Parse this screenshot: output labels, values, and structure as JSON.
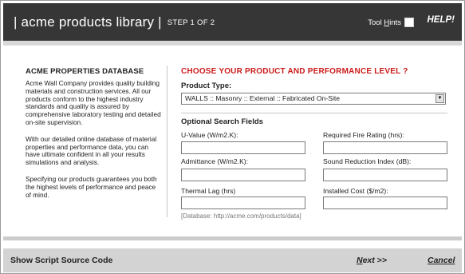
{
  "header": {
    "title": "| acme products library |",
    "step": "STEP 1 OF 2",
    "tool_hints_prefix": "Tool ",
    "tool_hints_underlined": "H",
    "tool_hints_suffix": "ints",
    "tool_hints_checked": false,
    "help": "HELP!"
  },
  "sidebar": {
    "heading": "ACME PROPERTIES DATABASE",
    "paragraphs": [
      "Acme Wall Company provides quality building materials and construction services. All our products conform to the highest industry standards and quality is assured by comprehensive laboratory testing and detailed on-site supervision.",
      "With our detailed online database of material properties and performance data, you can have ultimate confident in all your results simulations and analysis.",
      "Specifying our products guarantees you both the highest levels of performance and peace of mind."
    ]
  },
  "main": {
    "title": "CHOOSE YOUR PRODUCT AND PERFORMANCE LEVEL ?",
    "product_type_label": "Product Type:",
    "product_type_value": "WALLS :: Masonry :: External :: Fabricated On-Site",
    "optional_label": "Optional Search Fields",
    "fields": {
      "u_value": {
        "label": "U-Value (W/m2.K):",
        "value": ""
      },
      "fire_rating": {
        "label": "Required Fire Rating (hrs):",
        "value": ""
      },
      "admittance": {
        "label": "Admittance (W/m2.K):",
        "value": ""
      },
      "sound_reduction": {
        "label": "Sound Reduction Index (dB):",
        "value": ""
      },
      "thermal_lag": {
        "label": "Thermal Lag (hrs)",
        "value": ""
      },
      "installed_cost": {
        "label": "Installed Cost ($/m2):",
        "value": ""
      }
    },
    "database_note": "[Database: http://acme.com/products/data]"
  },
  "footer": {
    "script_source": "Show Script Source Code",
    "next_underlined": "N",
    "next_rest": "ext >>",
    "cancel": "Cancel"
  },
  "colors": {
    "header_bg": "#363636",
    "accent_red": "#cc1a1a",
    "footer_bg": "#d3d3d3"
  },
  "icons": {
    "select_arrow": "dropdown-arrow-icon"
  }
}
